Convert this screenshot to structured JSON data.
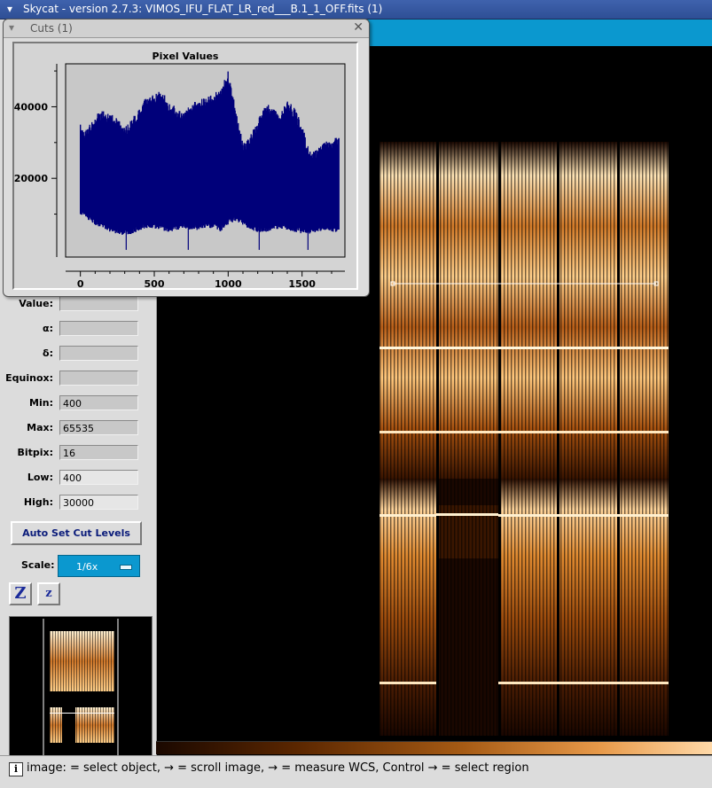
{
  "window": {
    "title": "Skycat - version 2.7.3: VIMOS_IFU_FLAT_LR_red___B.1_1_OFF.fits (1)",
    "menu_icon": "chevron-down-icon"
  },
  "cuts_window": {
    "title": "Cuts (1)",
    "close_icon": "close-icon",
    "chart_title": "Pixel Values"
  },
  "chart_data": {
    "type": "line",
    "title": "Pixel Values",
    "xlabel": "",
    "ylabel": "",
    "xlim": [
      -100,
      1790
    ],
    "ylim": [
      -2000,
      52000
    ],
    "xticks": [
      0,
      500,
      1000,
      1500
    ],
    "xtick_labels": [
      "0",
      "500",
      "1000",
      "1500"
    ],
    "yticks": [
      20000,
      40000
    ],
    "ytick_labels": [
      "20000",
      "40000"
    ],
    "grid": false,
    "series": [
      {
        "color": "#00007a",
        "x": [
          0,
          50,
          100,
          150,
          200,
          250,
          300,
          350,
          400,
          450,
          500,
          550,
          600,
          650,
          700,
          750,
          800,
          850,
          900,
          950,
          1000,
          1050,
          1100,
          1150,
          1200,
          1250,
          1300,
          1350,
          1400,
          1450,
          1500,
          1550,
          1600,
          1650,
          1700,
          1750
        ],
        "upper": [
          35000,
          34000,
          38000,
          39000,
          38000,
          37000,
          34000,
          37000,
          40000,
          43000,
          43500,
          45000,
          41000,
          40000,
          38000,
          41000,
          42000,
          42500,
          44000,
          45000,
          50000,
          40000,
          30000,
          32000,
          36000,
          41000,
          40000,
          38000,
          42000,
          39500,
          35000,
          27500,
          28000,
          30000,
          31000,
          32000
        ],
        "lower": [
          10000,
          8500,
          7000,
          6000,
          5000,
          4500,
          4000,
          4500,
          5500,
          6000,
          6000,
          5500,
          5000,
          5500,
          6000,
          5500,
          5500,
          6000,
          6000,
          5000,
          7000,
          8000,
          7000,
          5500,
          5000,
          5000,
          5500,
          6000,
          5500,
          5000,
          4500,
          4500,
          5000,
          5500,
          5000,
          5000
        ]
      }
    ]
  },
  "fields": [
    {
      "label": "Value:",
      "value": ""
    },
    {
      "label": "α:",
      "value": ""
    },
    {
      "label": "δ:",
      "value": ""
    },
    {
      "label": "Equinox:",
      "value": ""
    },
    {
      "label": "Min:",
      "value": "400"
    },
    {
      "label": "Max:",
      "value": "65535"
    },
    {
      "label": "Bitpix:",
      "value": "16"
    },
    {
      "label": "Low:",
      "value": "400"
    },
    {
      "label": "High:",
      "value": "30000"
    }
  ],
  "buttons": {
    "auto_cut": "Auto Set Cut Levels",
    "zoom_in": "Z",
    "zoom_out": "z"
  },
  "scale": {
    "label": "Scale:",
    "value": "1/6x"
  },
  "status": {
    "icon": "i",
    "text": "image:  = select object,  →  = scroll image,  →  = measure WCS, Control →  = select region"
  },
  "colors": {
    "title_bar": "#3f62ad",
    "accent": "#0b98cf",
    "plot_line": "#00007a",
    "panel": "#dcdcdc"
  }
}
